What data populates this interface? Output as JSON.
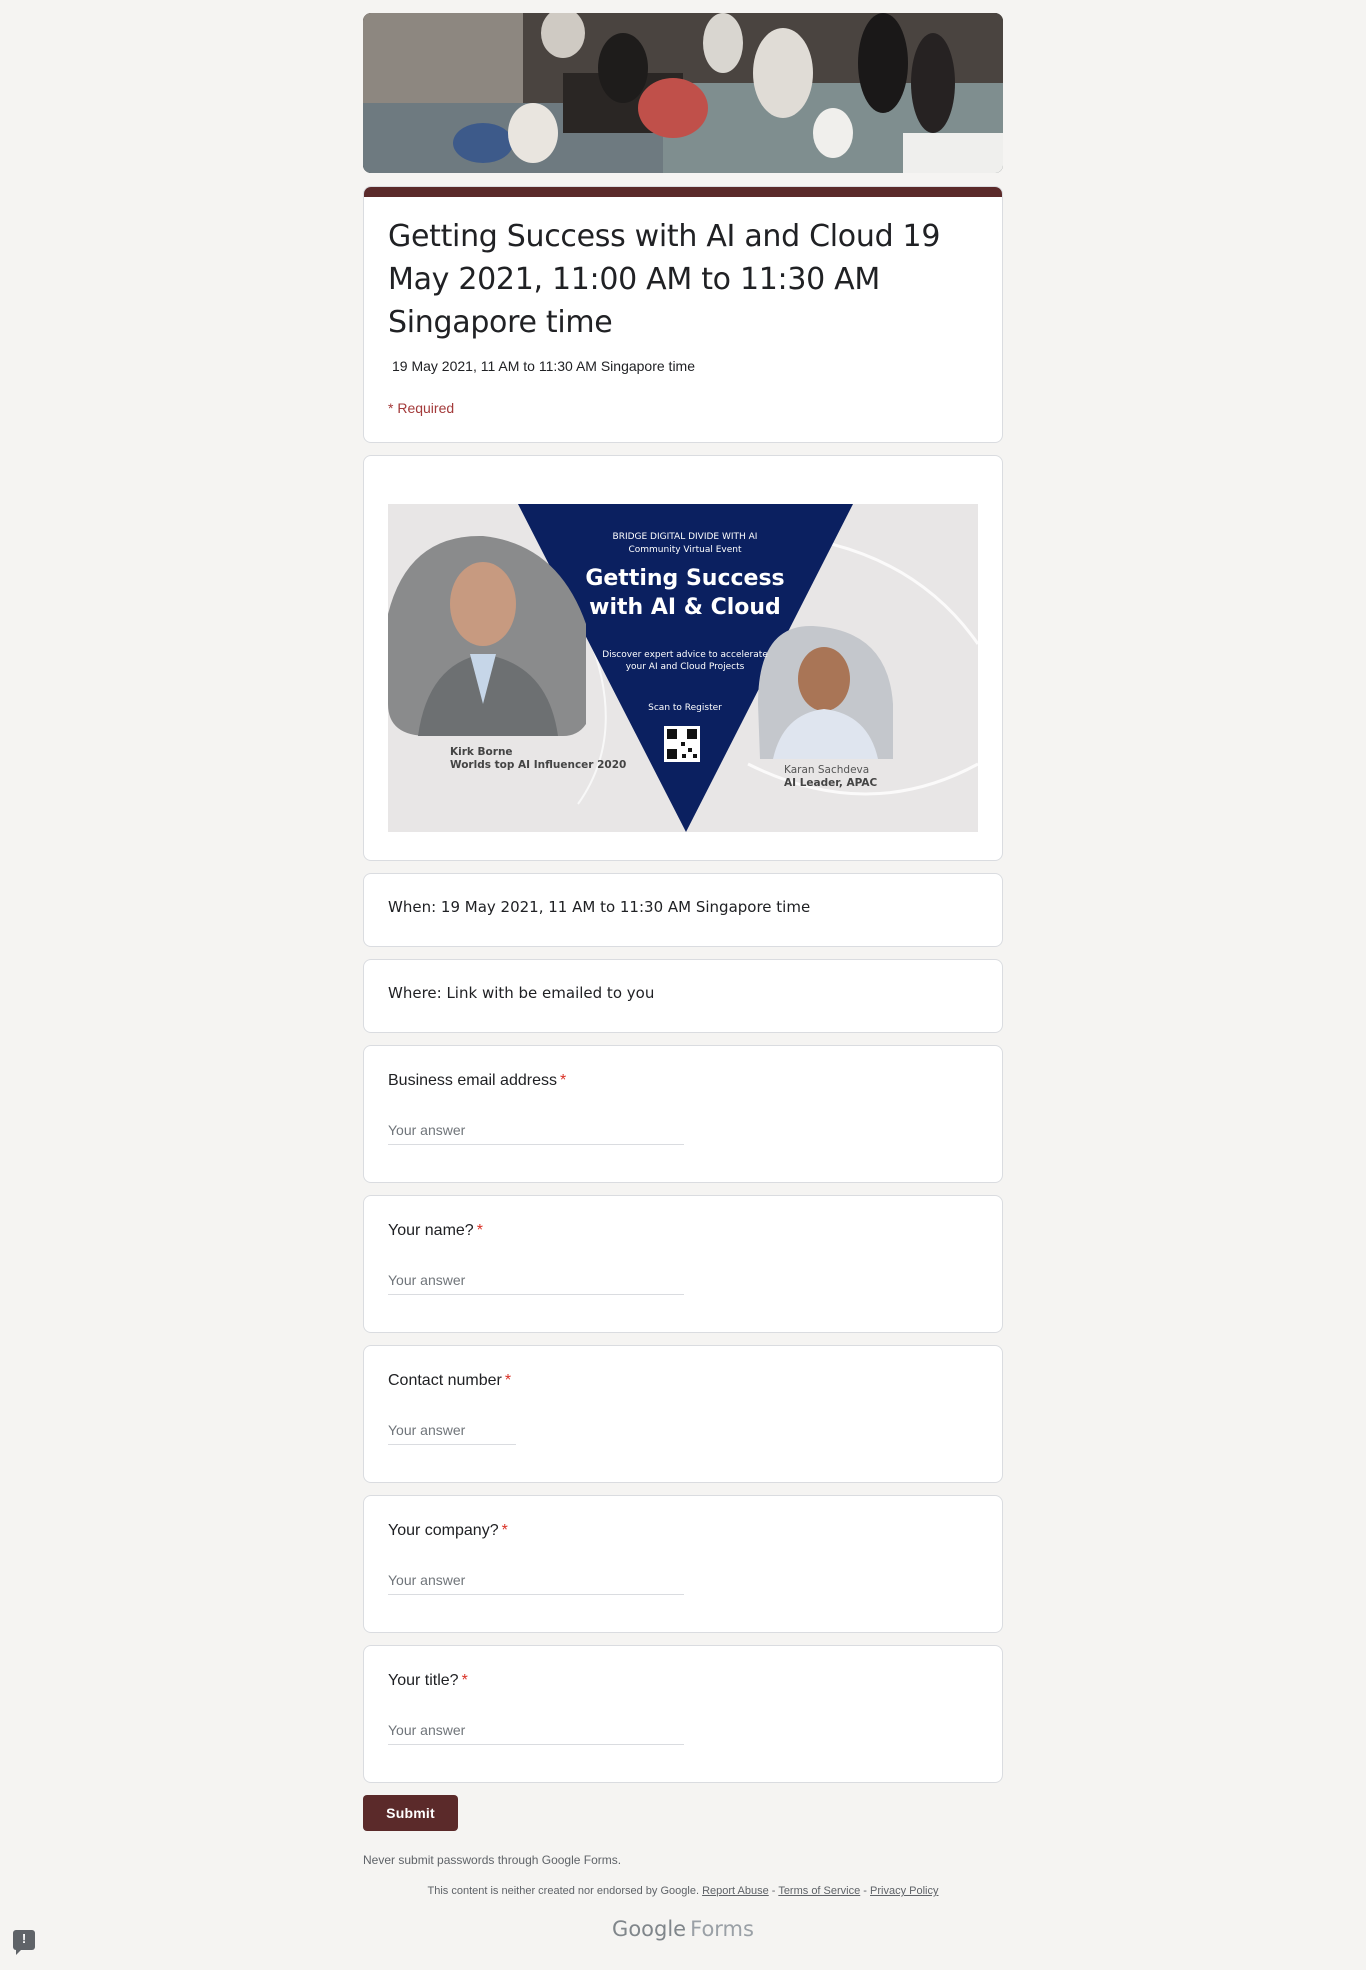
{
  "form": {
    "title": "Getting Success with AI and Cloud 19 May 2021, 11:00 AM to 11:30 AM Singapore time",
    "description": "19 May 2021, 11 AM to 11:30 AM Singapore time",
    "required_note": "* Required"
  },
  "promo": {
    "eyebrow_line1": "BRIDGE DIGITAL DIVIDE WITH AI",
    "eyebrow_line2": "Community Virtual Event",
    "headline_line1": "Getting Success",
    "headline_line2": "with AI & Cloud",
    "tagline_line1": "Discover expert advice to accelerate",
    "tagline_line2": "your AI and Cloud Projects",
    "scan_text": "Scan to Register",
    "speaker1_name": "Kirk Borne",
    "speaker1_title": "Worlds top AI Influencer 2020",
    "speaker2_name": "Karan Sachdeva",
    "speaker2_title": "AI Leader, APAC"
  },
  "info": {
    "when": "When: 19 May 2021, 11 AM to 11:30 AM Singapore time",
    "where": "Where: Link with be emailed to you"
  },
  "questions": [
    {
      "label": "Business email address",
      "required": "*",
      "placeholder": "Your answer"
    },
    {
      "label": "Your name?",
      "required": "*",
      "placeholder": "Your answer"
    },
    {
      "label": "Contact number",
      "required": "*",
      "placeholder": "Your answer"
    },
    {
      "label": "Your company?",
      "required": "*",
      "placeholder": "Your answer"
    },
    {
      "label": "Your title?",
      "required": "*",
      "placeholder": "Your answer"
    }
  ],
  "submit_label": "Submit",
  "footer": {
    "never_note": "Never submit passwords through Google Forms.",
    "disclaimer": "This content is neither created nor endorsed by Google.",
    "report_abuse": "Report Abuse",
    "terms": "Terms of Service",
    "privacy": "Privacy Policy",
    "separator": " - ",
    "brand_google": "Google",
    "brand_forms": "Forms"
  },
  "feedback_icon": "!",
  "colors": {
    "theme": "#5b2a2a",
    "required_star": "#d93025",
    "background": "#f5f4f2",
    "promo_navy": "#0b2060"
  },
  "icons": {
    "feedback": "report-issue-icon",
    "qr": "qr-code-icon"
  }
}
